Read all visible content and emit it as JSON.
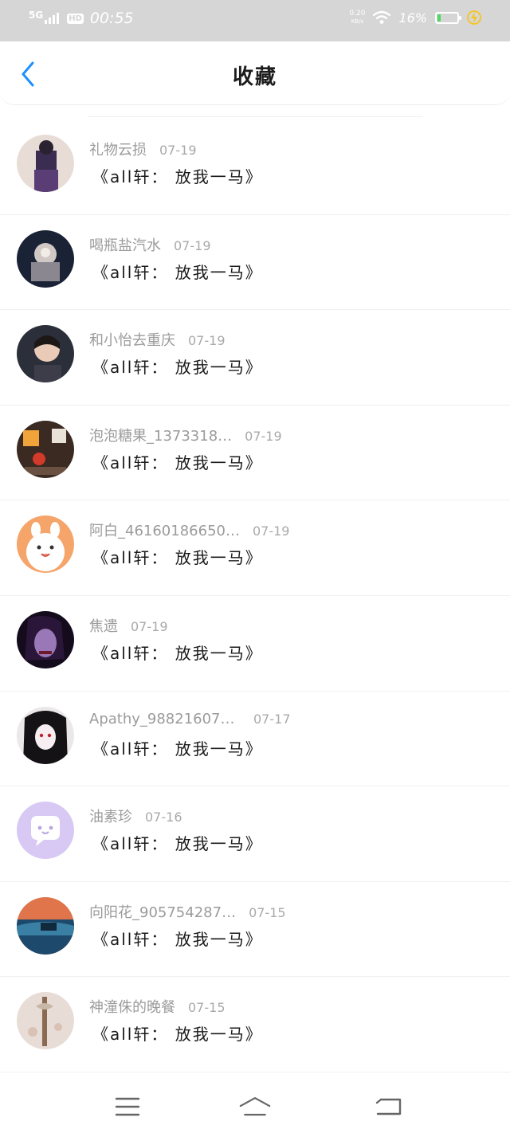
{
  "status_bar": {
    "network": "5G",
    "hd": "HD",
    "time": "00:55",
    "speed_value": "0.20",
    "speed_unit": "KB/s",
    "battery_percent": "16%",
    "battery_level": 0.16,
    "icons": [
      "signal-icon",
      "wifi-icon",
      "battery-icon",
      "charging-icon"
    ]
  },
  "nav": {
    "back_icon": "chevron-left-icon",
    "title": "收藏",
    "accent_color": "#1e90ff"
  },
  "items": [
    {
      "name": "礼物云损",
      "date": "07-19",
      "content": "《all轩： 放我一马》"
    },
    {
      "name": "喝瓶盐汽水",
      "date": "07-19",
      "content": "《all轩： 放我一马》"
    },
    {
      "name": "和小怡去重庆",
      "date": "07-19",
      "content": "《all轩： 放我一马》"
    },
    {
      "name": "泡泡糖果_1373318…",
      "date": "07-19",
      "content": "《all轩： 放我一马》"
    },
    {
      "name": "阿白_46160186650…",
      "date": "07-19",
      "content": "《all轩： 放我一马》"
    },
    {
      "name": "焦遗",
      "date": "07-19",
      "content": "《all轩： 放我一马》"
    },
    {
      "name": "Apathy_9882160708…",
      "date": "07-17",
      "content": "《all轩： 放我一马》"
    },
    {
      "name": "油素珍",
      "date": "07-16",
      "content": "《all轩： 放我一马》"
    },
    {
      "name": "向阳花_905754287…",
      "date": "07-15",
      "content": "《all轩： 放我一马》"
    },
    {
      "name": "神潼侏的晚餐",
      "date": "07-15",
      "content": "《all轩： 放我一马》"
    }
  ],
  "bottom_nav": {
    "icons": [
      "menu-icon",
      "home-icon",
      "return-icon"
    ]
  }
}
